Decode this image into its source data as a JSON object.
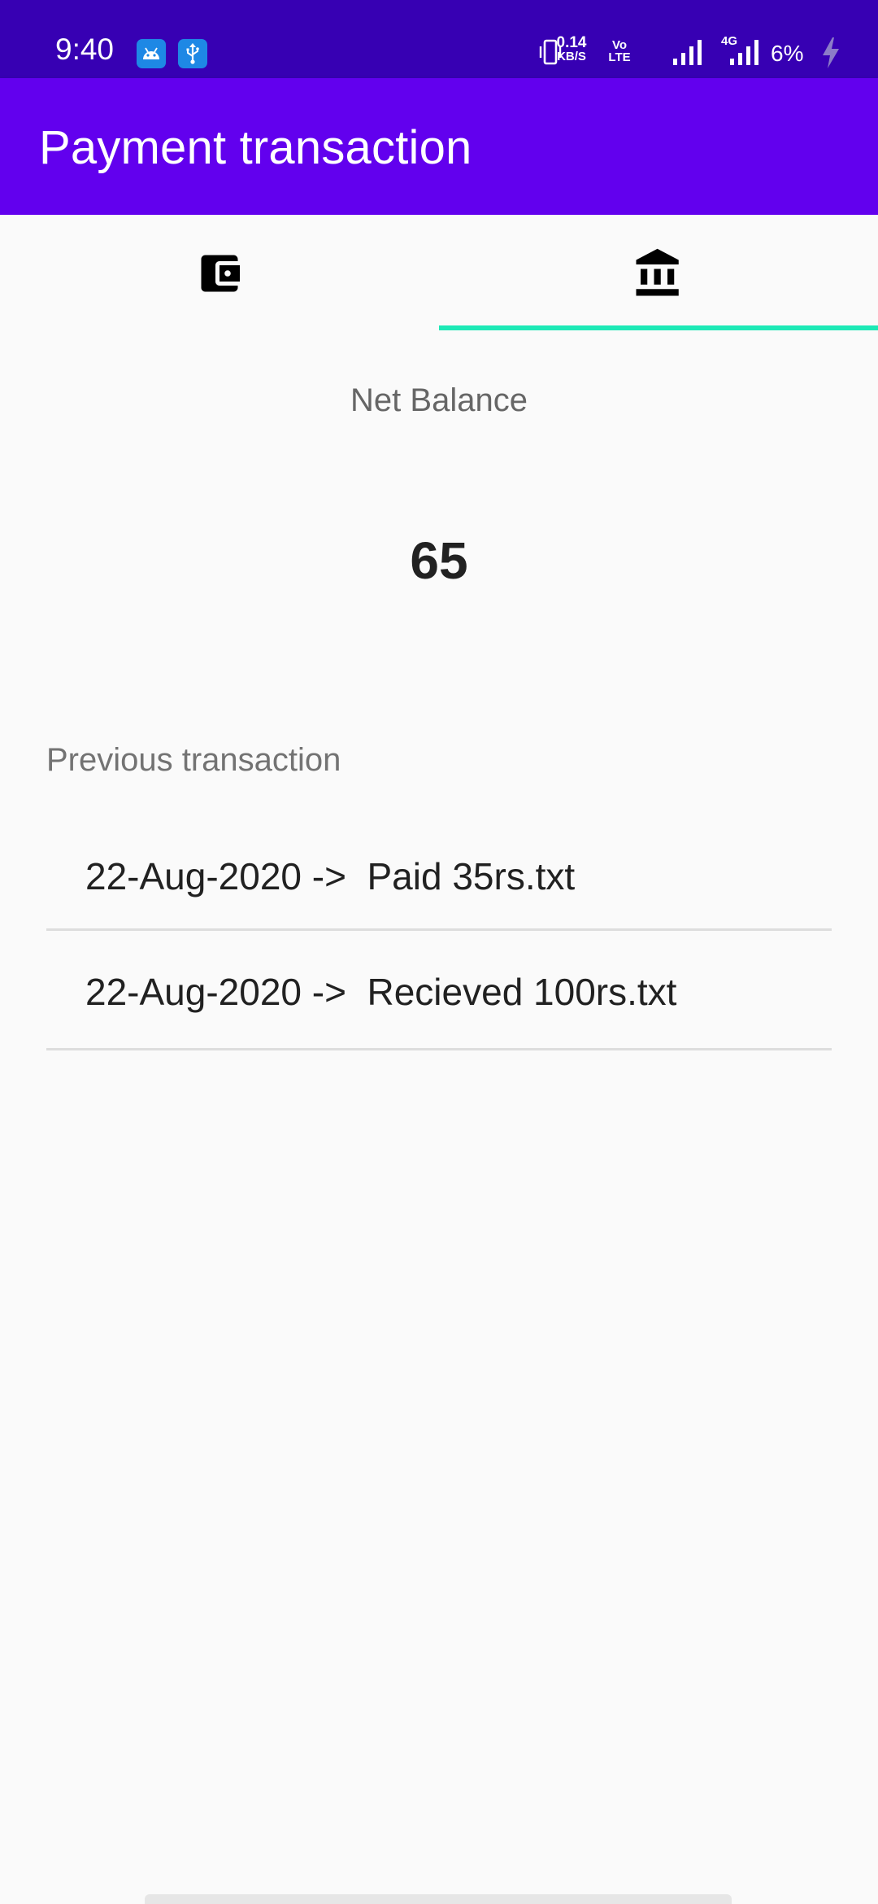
{
  "status_bar": {
    "time": "9:40",
    "speed_value": "0.14",
    "speed_unit": "KB/S",
    "volte": "Vo LTE",
    "network": "4G",
    "battery_text": "6%",
    "icons": [
      "android-icon",
      "usb-icon",
      "vibrate-icon",
      "signal-icon",
      "signal-4g-icon",
      "charging-icon"
    ]
  },
  "app_bar": {
    "title": "Payment transaction"
  },
  "tabs": [
    {
      "icon": "wallet-icon",
      "selected": false
    },
    {
      "icon": "bank-icon",
      "selected": true
    }
  ],
  "balance": {
    "label": "Net Balance",
    "value": "65"
  },
  "history": {
    "label": "Previous transaction",
    "items": [
      {
        "text": "22-Aug-2020 ->  Paid 35rs.txt"
      },
      {
        "text": "22-Aug-2020 ->  Recieved 100rs.txt"
      }
    ]
  },
  "colors": {
    "status_bar": "#3700b3",
    "app_bar": "#6200ee",
    "tab_indicator": "#1de9b6",
    "background": "#fafafa"
  }
}
